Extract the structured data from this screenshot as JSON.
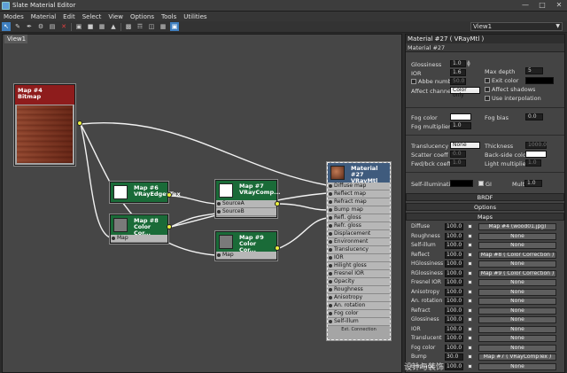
{
  "window": {
    "title": "Slate Material Editor"
  },
  "menu": [
    "Modes",
    "Material",
    "Edit",
    "Select",
    "View",
    "Options",
    "Tools",
    "Utilities"
  ],
  "toolbar": {
    "view_select": "View1"
  },
  "canvas": {
    "tab": "View1"
  },
  "nodes": {
    "bitmap": {
      "title": "Map #4",
      "subtitle": "Bitmap"
    },
    "edges": {
      "title": "Map #6",
      "subtitle": "VRayEdgesTex"
    },
    "cc1": {
      "title": "Map #8",
      "subtitle": "Color Cor...",
      "slots": [
        "Map"
      ]
    },
    "comp": {
      "title": "Map #7",
      "subtitle": "VRayComp...",
      "slots": [
        "SourceA",
        "SourceB"
      ]
    },
    "cc2": {
      "title": "Map #9",
      "subtitle": "Color Cor...",
      "slots": [
        "Map"
      ]
    },
    "material": {
      "title": "Material #27",
      "subtitle": "VRayMtl",
      "slots": [
        "Diffuse map",
        "Reflect map",
        "Refract map",
        "Bump map",
        "Refl. gloss",
        "Refr. gloss",
        "Displacement",
        "Environment",
        "Translucency",
        "IOR",
        "Hilight gloss",
        "Fresnel IOR",
        "Opacity",
        "Roughness",
        "Anisotropy",
        "An. rotation",
        "Fog color",
        "Self-illum"
      ],
      "footer": "Ext. Connection"
    }
  },
  "panel": {
    "title": "Material #27  ( VRayMtl )",
    "name": "Material #27",
    "glossiness_label": "Glossiness",
    "glossiness": "1.0",
    "ior_label": "IOR",
    "ior": "1.6",
    "abbe_label": "Abbe number",
    "abbe": "50.0",
    "affect_label": "Affect channels",
    "affect": "Color only",
    "maxdepth_label": "Max depth",
    "maxdepth": "5",
    "exitcolor_label": "Exit color",
    "affectshadows_label": "Affect shadows",
    "useinterp_label": "Use interpolation",
    "fogcolor_label": "Fog color",
    "fogbias_label": "Fog bias",
    "fogbias": "0.0",
    "fogmult_label": "Fog multiplier",
    "fogmult": "1.0",
    "transl_label": "Translucency",
    "transl": "None",
    "thickness_label": "Thickness",
    "thickness": "1000.0",
    "scatter_label": "Scatter coeff",
    "scatter": "0.0",
    "backside_label": "Back-side color",
    "fwdbck_label": "Fwd/bck coeff",
    "fwdbck": "1.0",
    "lightmult_label": "Light multiplier",
    "lightmult": "1.0",
    "selfillum_label": "Self-illumination",
    "gi_label": "GI",
    "mult_label": "Mult",
    "mult": "1.0",
    "rollouts": [
      "BRDF",
      "Options",
      "Maps"
    ],
    "maps": [
      {
        "label": "Diffuse",
        "value": "100.0",
        "map": "Map #4 (wood01.jpg)"
      },
      {
        "label": "Roughness",
        "value": "100.0",
        "map": "None"
      },
      {
        "label": "Self-illum",
        "value": "100.0",
        "map": "None"
      },
      {
        "label": "Reflect",
        "value": "100.0",
        "map": "Map #8  ( Color Correction )"
      },
      {
        "label": "HGlossiness",
        "value": "100.0",
        "map": "None"
      },
      {
        "label": "RGlossiness",
        "value": "100.0",
        "map": "Map #9  ( Color Correction )"
      },
      {
        "label": "Fresnel IOR",
        "value": "100.0",
        "map": "None"
      },
      {
        "label": "Anisotropy",
        "value": "100.0",
        "map": "None"
      },
      {
        "label": "An. rotation",
        "value": "100.0",
        "map": "None"
      },
      {
        "label": "Refract",
        "value": "100.0",
        "map": "None"
      },
      {
        "label": "Glossiness",
        "value": "100.0",
        "map": "None"
      },
      {
        "label": "IOR",
        "value": "100.0",
        "map": "None"
      },
      {
        "label": "Translucent",
        "value": "100.0",
        "map": "None"
      },
      {
        "label": "Fog color",
        "value": "100.0",
        "map": "None"
      },
      {
        "label": "Bump",
        "value": "30.0",
        "map": "Map #7  ( VRayCompTex )"
      },
      {
        "label": "Displace",
        "value": "100.0",
        "map": "None"
      }
    ]
  },
  "watermark": "设计与装饰"
}
